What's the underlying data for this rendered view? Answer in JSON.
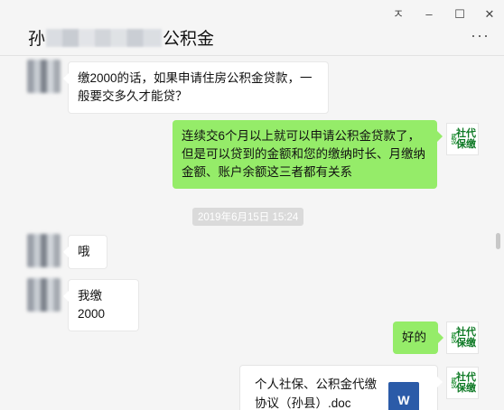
{
  "window": {
    "pin_label": "ㅈ",
    "minimize_label": "–",
    "maximize_label": "☐",
    "close_label": "✕"
  },
  "header": {
    "title_prefix": "孙",
    "title_suffix": "公积金",
    "more_label": "···"
  },
  "messages": [
    {
      "side": "left",
      "text": "缴2000的话，如果申请住房公积金贷款，一般要交多久才能贷？"
    },
    {
      "side": "right",
      "text": "连续交6个月以上就可以申请公积金贷款了，但是可以贷到的金额和您的缴纳时长、月缴纳金额、账户余额这三者都有关系"
    },
    {
      "side": "left",
      "text": "哦"
    },
    {
      "side": "left",
      "text": "我缴2000"
    },
    {
      "side": "right",
      "text": "好的"
    }
  ],
  "timestamp": "2019年6月15日 15:24",
  "file": {
    "name": "个人社保、公积金代缴协议（孙县）.doc",
    "icon_label": "W",
    "icon_color": "#2b5ba8"
  },
  "logo": {
    "small_text": "武汉",
    "big_text_line1": "社代",
    "big_text_line2": "保缴"
  },
  "colors": {
    "own_bubble": "#95ec69",
    "other_bubble": "#ffffff",
    "background": "#f5f5f5"
  }
}
